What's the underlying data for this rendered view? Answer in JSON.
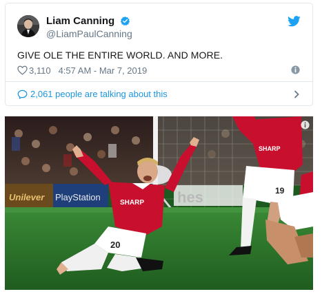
{
  "tweet": {
    "author_name": "Liam Canning",
    "handle": "@LiamPaulCanning",
    "text": "GIVE OLE THE ENTIRE WORLD. AND MORE.",
    "likes": "3,110",
    "timestamp": "4:57 AM - Mar 7, 2019",
    "talking": "2,061 people are talking about this",
    "icons": [
      "verified-badge-icon",
      "twitter-bird-icon",
      "heart-icon",
      "info-icon",
      "comment-bubble-icon",
      "chevron-right-icon"
    ]
  },
  "photo": {
    "ad_board_left": "Unilever",
    "ad_board_mid": "PlayStation",
    "ad_board_right": "hes",
    "shirt_sponsor": "SHARP",
    "shirt_sponsor_right": "SHARP",
    "player_number_left": "20",
    "player_number_right": "19"
  },
  "colors": {
    "accent_blue": "#1da1f2",
    "link_blue": "#1b95e0",
    "muted_gray": "#657786",
    "border": "#e1e8ed",
    "kit_red": "#c8102e",
    "pitch_green": "#2c7a2a"
  }
}
